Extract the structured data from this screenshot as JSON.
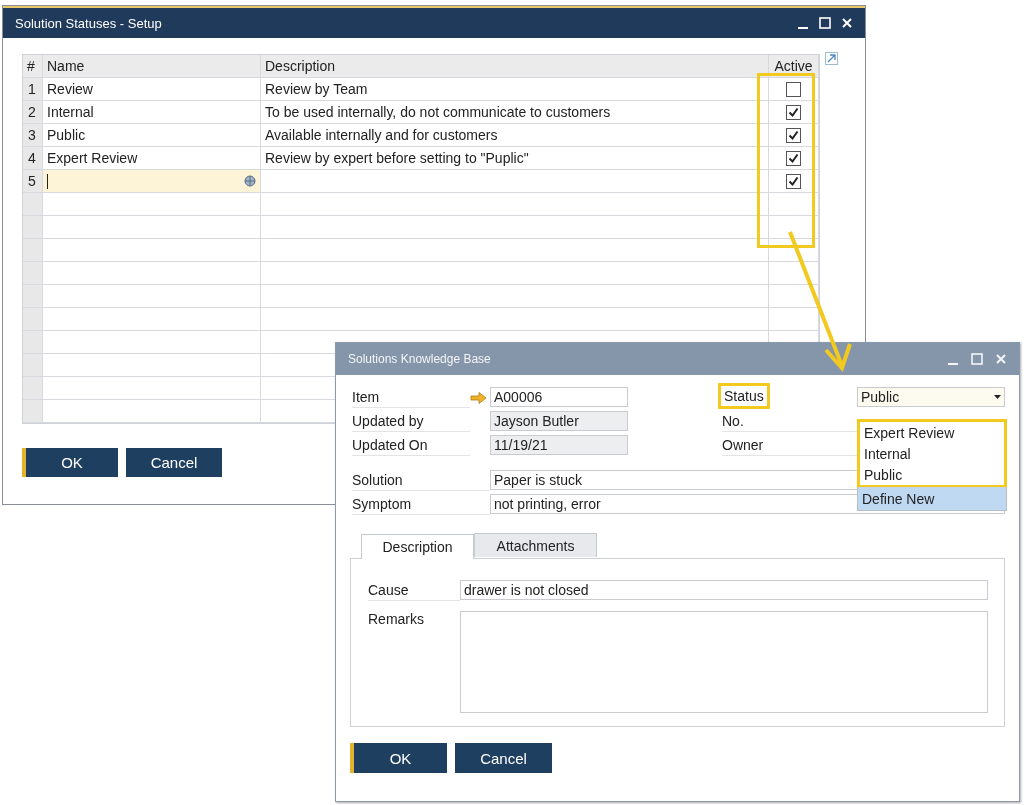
{
  "setup_window": {
    "title": "Solution Statuses - Setup",
    "columns": [
      "#",
      "Name",
      "Description",
      "Active"
    ],
    "rows": [
      {
        "number": "1",
        "name": "Review",
        "description": "Review by Team",
        "active": false,
        "editing": false
      },
      {
        "number": "2",
        "name": "Internal",
        "description": "To be used internally, do not communicate to customers",
        "active": true,
        "editing": false
      },
      {
        "number": "3",
        "name": "Public",
        "description": "Available internally and for customers",
        "active": true,
        "editing": false
      },
      {
        "number": "4",
        "name": "Expert Review",
        "description": "Review by expert before setting to \"Puplic\"",
        "active": true,
        "editing": false
      },
      {
        "number": "5",
        "active": true,
        "editing": true
      }
    ],
    "buttons": [
      "OK",
      "Cancel"
    ]
  },
  "kb_window": {
    "title": "Solutions Knowledge Base",
    "left_fields": [
      {
        "label": "Item",
        "value": "A00006",
        "kind": "link"
      },
      {
        "label": "Updated by",
        "value": "Jayson Butler",
        "kind": "readonly"
      },
      {
        "label": "Updated On",
        "value": "11/19/21",
        "kind": "readonly"
      }
    ],
    "right_fields": [
      {
        "label": "Status",
        "kind": "dropdown",
        "value": "Public"
      },
      {
        "label": "No.",
        "kind": "plain"
      },
      {
        "label": "Owner",
        "kind": "plain"
      }
    ],
    "status_options": [
      {
        "label": "Expert Review",
        "selected": false
      },
      {
        "label": "Internal",
        "selected": false
      },
      {
        "label": "Public",
        "selected": false
      },
      {
        "label": "Define New",
        "selected": true
      }
    ],
    "solution": {
      "label": "Solution",
      "value": "Paper is stuck"
    },
    "symptom": {
      "label": "Symptom",
      "value": "not printing, error"
    },
    "tabs": [
      {
        "label": "Description",
        "selected": true
      },
      {
        "label": "Attachments",
        "selected": false
      }
    ],
    "cause": {
      "label": "Cause",
      "value": "drawer is not closed"
    },
    "remarks": {
      "label": "Remarks"
    },
    "buttons": [
      "OK",
      "Cancel"
    ]
  }
}
